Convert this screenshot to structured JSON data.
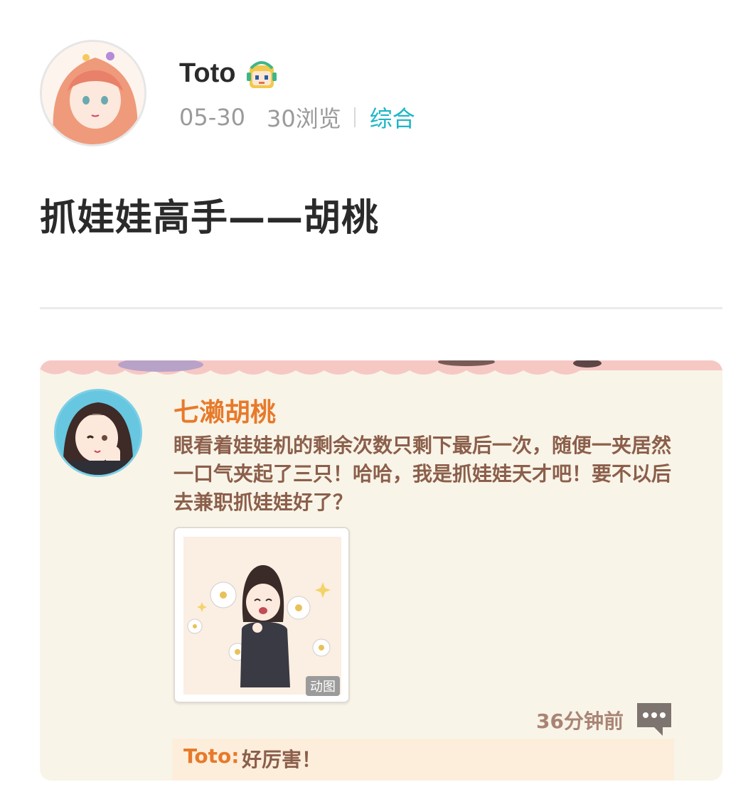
{
  "post": {
    "author": "Toto",
    "date": "05-30",
    "views": "30浏览",
    "category": "综合",
    "title": "抓娃娃高手——胡桃"
  },
  "card": {
    "sender": "七濑胡桃",
    "message": "眼看着娃娃机的剩余次数只剩下最后一次，随便一夹居然一口气夹起了三只！哈哈，我是抓娃娃天才吧！要不以后去兼职抓娃娃好了？",
    "image_tag": "动图",
    "time": "36分钟前",
    "reply_user": "Toto:",
    "reply_text": "好厉害！"
  },
  "colors": {
    "accent": "#1db6c6",
    "orange": "#e77a2a",
    "brown_text": "#8b5f4b",
    "card_bg": "#f9f4e8"
  },
  "icons": {
    "badge": "pixel-girl-badge-icon",
    "more": "speech-bubble-dots-icon"
  }
}
